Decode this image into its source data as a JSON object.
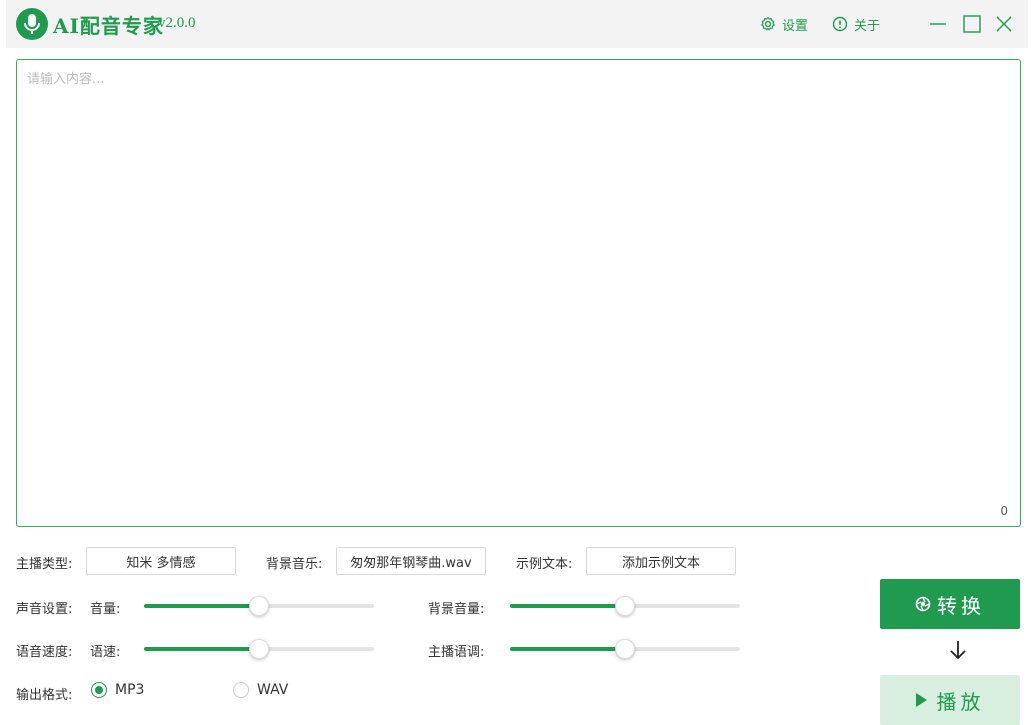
{
  "header": {
    "title": "AI配音专家",
    "version": "v2.0.0",
    "settings_label": "设置",
    "about_label": "关于",
    "accent_color": "#1f9a4f"
  },
  "editor": {
    "placeholder": "请输入内容...",
    "value": "",
    "char_count": "0"
  },
  "controls": {
    "anchor_type_label": "主播类型:",
    "anchor_type_value": "知米 多情感",
    "bgm_label": "背景音乐:",
    "bgm_value": "匆匆那年钢琴曲.wav",
    "sample_text_label": "示例文本:",
    "sample_text_button": "添加示例文本",
    "sound_settings_label": "声音设置:",
    "volume_label": "音量:",
    "bg_volume_label": "背景音量:",
    "speech_speed_label": "语音速度:",
    "speed_label": "语速:",
    "pitch_label": "主播语调:",
    "output_format_label": "输出格式:"
  },
  "sliders": {
    "volume": 0.5,
    "bg_volume": 0.5,
    "speed": 0.5,
    "pitch": 0.5
  },
  "format": {
    "options": [
      "MP3",
      "WAV"
    ],
    "selected": "MP3"
  },
  "actions": {
    "convert_label": "转换",
    "play_label": "播放"
  }
}
